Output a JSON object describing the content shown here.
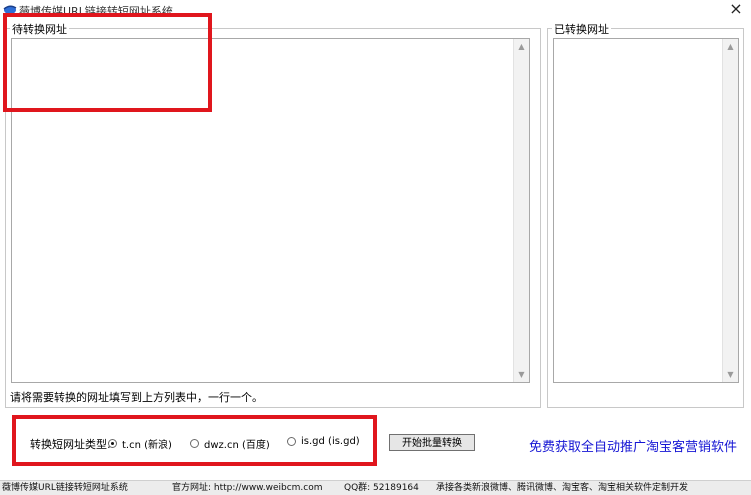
{
  "window": {
    "title": "薇博传媒URL链接转短网址系统",
    "close_symbol": "×"
  },
  "input_panel": {
    "label": "待转换网址",
    "value": "",
    "hint": "请将需要转换的网址填写到上方列表中，一行一个。"
  },
  "output_panel": {
    "label": "已转换网址",
    "value": ""
  },
  "options": {
    "type_label": "转换短网址类型:",
    "radios": [
      {
        "label": "t.cn (新浪)",
        "selected": true
      },
      {
        "label": "dwz.cn (百度)",
        "selected": false
      },
      {
        "label": "is.gd (is.gd)",
        "selected": false
      }
    ],
    "start_button": "开始批量转换",
    "promo_link": "免费获取全自动推广淘宝客营销软件"
  },
  "statusbar": {
    "app_name": "薇博传媒URL链接转短网址系统",
    "website": "官方网址: http://www.weibcm.com",
    "qq_group": "QQ群: 52189164",
    "services": "承接各类新浪微博、腾讯微博、淘宝客、淘宝相关软件定制开发"
  },
  "icons": {
    "app": "browser-globe-icon",
    "scroll_up": "chevron-up-icon",
    "scroll_down": "chevron-down-icon"
  },
  "colors": {
    "highlight": "#e0161d",
    "link": "#1515d4"
  }
}
